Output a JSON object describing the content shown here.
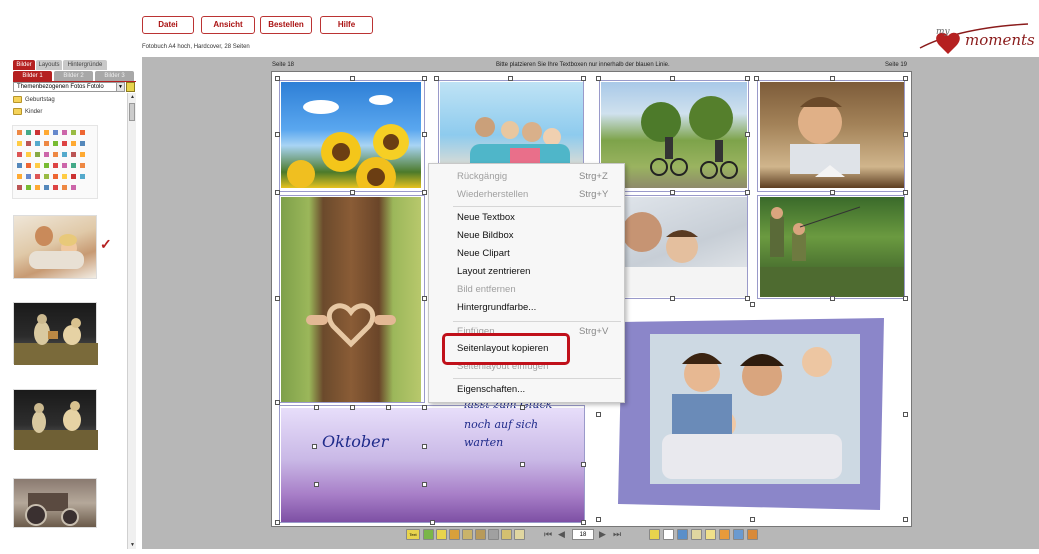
{
  "menu": {
    "datei": "Datei",
    "ansicht": "Ansicht",
    "bestellen": "Bestellen",
    "hilfe": "Hilfe"
  },
  "product_info": "Fotobuch A4 hoch, Hardcover, 28 Seiten",
  "logo": {
    "prefix": "my",
    "text": "moments"
  },
  "sidebar": {
    "main_tabs": [
      "Bilder",
      "Layouts",
      "Hintergründe"
    ],
    "sub_tabs": [
      "Bilder 1",
      "Bilder 2",
      "Bilder 3"
    ],
    "dropdown_value": "Themenbezogenen Fotos Fotolo",
    "folders": [
      "Geburtstag",
      "Kinder"
    ]
  },
  "workspace": {
    "page_left": "Seite 18",
    "page_right": "Seite 19",
    "hint": "Bitte platzieren Sie Ihre Textboxen nur innerhalb der blauen Linie.",
    "month_text": "Oktober",
    "quote_line1": "lasst zum Glück",
    "quote_line2": "noch auf sich",
    "quote_line3": "warten"
  },
  "context_menu": {
    "items": [
      {
        "label": "Rückgängig",
        "shortcut": "Strg+Z",
        "disabled": true
      },
      {
        "label": "Wiederherstellen",
        "shortcut": "Strg+Y",
        "disabled": true
      },
      {
        "label": "Neue Textbox",
        "shortcut": "",
        "disabled": false
      },
      {
        "label": "Neue Bildbox",
        "shortcut": "",
        "disabled": false
      },
      {
        "label": "Neue Clipart",
        "shortcut": "",
        "disabled": false
      },
      {
        "label": "Layout zentrieren",
        "shortcut": "",
        "disabled": false
      },
      {
        "label": "Bild entfernen",
        "shortcut": "",
        "disabled": true
      },
      {
        "label": "Hintergrundfarbe...",
        "shortcut": "",
        "disabled": false
      },
      {
        "label": "Einfügen",
        "shortcut": "Strg+V",
        "disabled": true
      },
      {
        "label": "Seitenlayout kopieren",
        "shortcut": "",
        "disabled": false
      },
      {
        "label": "Seitenlayout einfügen",
        "shortcut": "",
        "disabled": true
      },
      {
        "label": "Eigenschaften...",
        "shortcut": "",
        "disabled": false
      }
    ]
  },
  "toolbar": {
    "text_label": "Text",
    "page_number": "18"
  },
  "colors": {
    "accent": "#b52020",
    "workspace_bg": "#b7b7b7",
    "highlight": "#c0101a",
    "script_text": "#1e2a8a"
  }
}
